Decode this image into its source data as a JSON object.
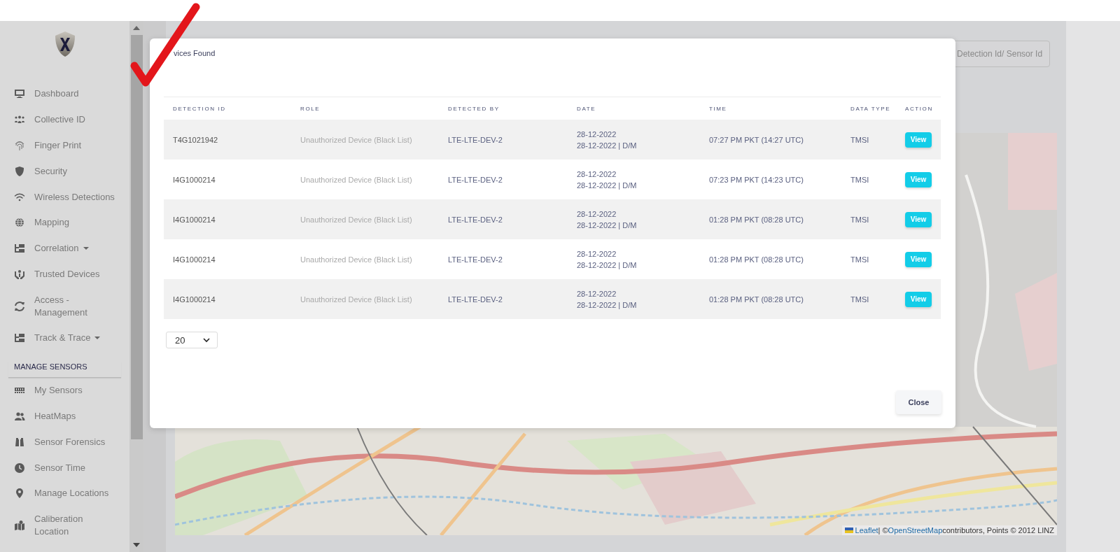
{
  "sidebar": {
    "nav_items": [
      {
        "label": "Dashboard",
        "dropdown": false
      },
      {
        "label": "Collective ID",
        "dropdown": false
      },
      {
        "label": "Finger Print",
        "dropdown": false
      },
      {
        "label": "Security",
        "dropdown": false
      },
      {
        "label": "Wireless Detections",
        "dropdown": false
      },
      {
        "label": "Mapping",
        "dropdown": false
      },
      {
        "label": "Correlation",
        "dropdown": true
      },
      {
        "label": "Trusted Devices",
        "dropdown": false
      },
      {
        "label": "Access -\nManagement",
        "dropdown": false
      },
      {
        "label": "Track & Trace",
        "dropdown": true
      }
    ],
    "section_heading": "MANAGE SENSORS",
    "sensor_items": [
      {
        "label": "My Sensors",
        "dropdown": false
      },
      {
        "label": "HeatMaps",
        "dropdown": false
      },
      {
        "label": "Sensor Forensics",
        "dropdown": false
      },
      {
        "label": "Sensor Time",
        "dropdown": false
      },
      {
        "label": "Manage Locations",
        "dropdown": false
      },
      {
        "label": "Caliberation\nLocation",
        "dropdown": false
      }
    ]
  },
  "search": {
    "placeholder": "Detection Id/ Sensor Id"
  },
  "map": {
    "kind": "picture",
    "attribution": {
      "leaflet_link": "Leaflet",
      "separator": "| ©",
      "osm_link": "OpenStreetMap",
      "rest": "contributors, Points © 2012 LINZ"
    }
  },
  "modal": {
    "title": "vices Found",
    "table": {
      "columns": [
        "DETECTION ID",
        "ROLE",
        "DETECTED BY",
        "DATE",
        "TIME",
        "DATA TYPE",
        "ACTION"
      ],
      "rows": [
        {
          "detection_id": "T4G1021942",
          "role": "Unauthorized Device (Black List)",
          "detected_by": "LTE-LTE-DEV-2",
          "date": [
            "28-12-2022",
            "28-12-2022 | D/M"
          ],
          "time": "07:27 PM PKT (14:27 UTC)",
          "data_type": "TMSI",
          "action": "View"
        },
        {
          "detection_id": "I4G1000214",
          "role": "Unauthorized Device (Black List)",
          "detected_by": "LTE-LTE-DEV-2",
          "date": [
            "28-12-2022",
            "28-12-2022 | D/M"
          ],
          "time": "07:23 PM PKT (14:23 UTC)",
          "data_type": "TMSI",
          "action": "View"
        },
        {
          "detection_id": "I4G1000214",
          "role": "Unauthorized Device (Black List)",
          "detected_by": "LTE-LTE-DEV-2",
          "date": [
            "28-12-2022",
            "28-12-2022 | D/M"
          ],
          "time": "01:28 PM PKT (08:28 UTC)",
          "data_type": "TMSI",
          "action": "View"
        },
        {
          "detection_id": "I4G1000214",
          "role": "Unauthorized Device (Black List)",
          "detected_by": "LTE-LTE-DEV-2",
          "date": [
            "28-12-2022",
            "28-12-2022 | D/M"
          ],
          "time": "01:28 PM PKT (08:28 UTC)",
          "data_type": "TMSI",
          "action": "View"
        },
        {
          "detection_id": "I4G1000214",
          "role": "Unauthorized Device (Black List)",
          "detected_by": "LTE-LTE-DEV-2",
          "date": [
            "28-12-2022",
            "28-12-2022 | D/M"
          ],
          "time": "01:28 PM PKT (08:28 UTC)",
          "data_type": "TMSI",
          "action": "View"
        }
      ]
    },
    "page_size": "20",
    "close_button": "Close"
  }
}
